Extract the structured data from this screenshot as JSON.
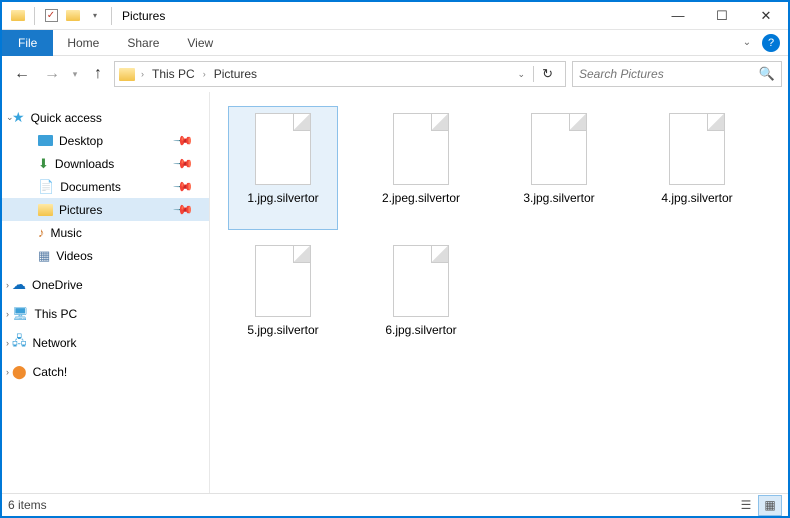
{
  "window": {
    "title": "Pictures"
  },
  "ribbon": {
    "file": "File",
    "tabs": [
      "Home",
      "Share",
      "View"
    ]
  },
  "breadcrumb": {
    "parts": [
      "This PC",
      "Pictures"
    ]
  },
  "search": {
    "placeholder": "Search Pictures"
  },
  "sidebar": {
    "quick": {
      "label": "Quick access",
      "items": [
        {
          "label": "Desktop",
          "pin": true,
          "iconclass": "icon-desktop"
        },
        {
          "label": "Downloads",
          "pin": true,
          "iconclass": "icon-download",
          "glyph": "⬇"
        },
        {
          "label": "Documents",
          "pin": true,
          "iconclass": "icon-docs",
          "glyph": "📄"
        },
        {
          "label": "Pictures",
          "pin": true,
          "iconclass": "icon-fld",
          "selected": true
        },
        {
          "label": "Music",
          "pin": false,
          "iconclass": "icon-music",
          "glyph": "♪"
        },
        {
          "label": "Videos",
          "pin": false,
          "iconclass": "icon-video",
          "glyph": "▦"
        }
      ]
    },
    "tops": [
      {
        "label": "OneDrive",
        "glyph": "☁",
        "iconclass": "icon-cloud"
      },
      {
        "label": "This PC",
        "glyph": "🖥",
        "iconclass": "icon-pc"
      },
      {
        "label": "Network",
        "glyph": "🖧",
        "iconclass": "icon-net"
      },
      {
        "label": "Catch!",
        "glyph": "⬤",
        "iconclass": "icon-catch"
      }
    ]
  },
  "files": [
    {
      "name": "1.jpg.silvertor",
      "selected": true
    },
    {
      "name": "2.jpeg.silvertor"
    },
    {
      "name": "3.jpg.silvertor"
    },
    {
      "name": "4.jpg.silvertor"
    },
    {
      "name": "5.jpg.silvertor"
    },
    {
      "name": "6.jpg.silvertor"
    }
  ],
  "status": {
    "count": "6 items"
  }
}
